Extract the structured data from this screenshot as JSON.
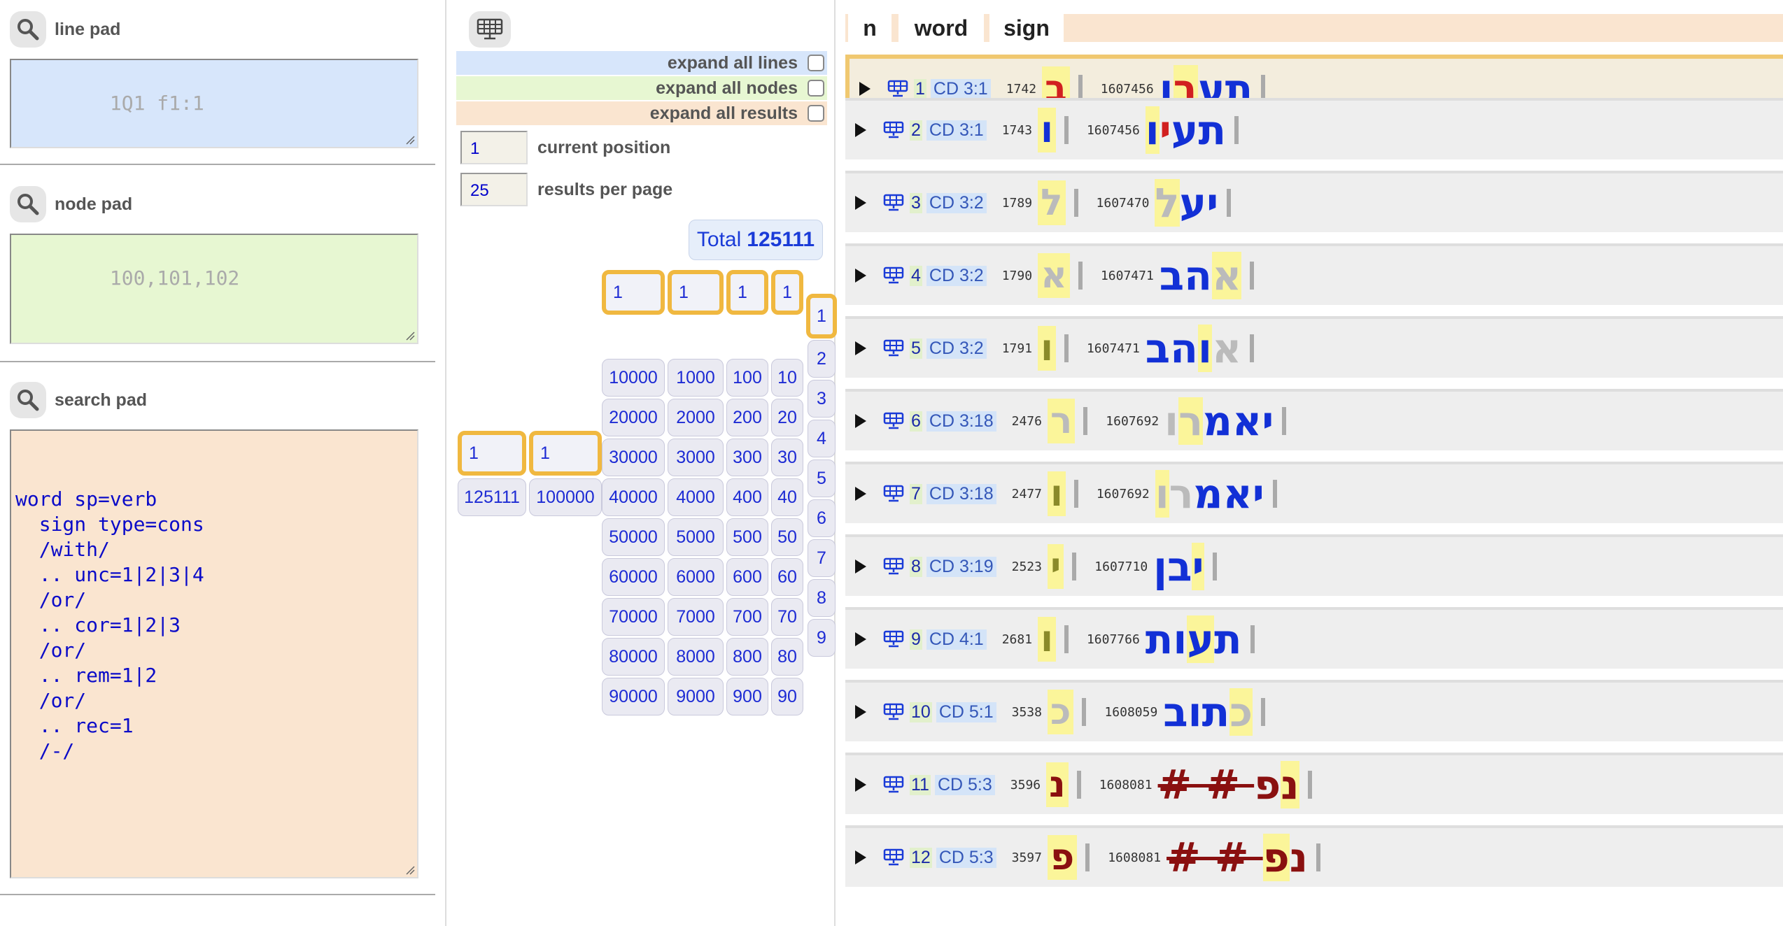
{
  "line_pad": {
    "title": "line pad",
    "placeholder": "1Q1 f1:1"
  },
  "node_pad": {
    "title": "node pad",
    "placeholder": "100,101,102"
  },
  "search_pad": {
    "title": "search pad",
    "lines": [
      "word sp=verb",
      "  sign type=cons",
      "  /with/",
      "  .. unc=1|2|3|4",
      "  /or/",
      "  .. cor=1|2|3",
      "  /or/",
      "  .. rem=1|2",
      "  /or/",
      "  .. rec=1",
      "  /-/"
    ]
  },
  "controls": {
    "expand_lines": "expand all lines",
    "expand_nodes": "expand all nodes",
    "expand_results": "expand all results",
    "current_position_value": "1",
    "current_position_label": "current position",
    "results_per_page_value": "25",
    "results_per_page_label": "results per page",
    "total_label": "Total",
    "total_value": "125111"
  },
  "navigator": {
    "big_selected": [
      "1",
      "1"
    ],
    "big_values": [
      "125111",
      "100000"
    ],
    "col_10000": [
      "1",
      "10000",
      "20000",
      "30000",
      "40000",
      "50000",
      "60000",
      "70000",
      "80000",
      "90000"
    ],
    "col_1000": [
      "1",
      "1000",
      "2000",
      "3000",
      "4000",
      "5000",
      "6000",
      "7000",
      "8000",
      "9000"
    ],
    "col_100": [
      "1",
      "100",
      "200",
      "300",
      "400",
      "500",
      "600",
      "700",
      "800",
      "900"
    ],
    "col_10": [
      "1",
      "10",
      "20",
      "30",
      "40",
      "50",
      "60",
      "70",
      "80",
      "90"
    ],
    "col_1": [
      "1",
      "2",
      "3",
      "4",
      "5",
      "6",
      "7",
      "8",
      "9"
    ]
  },
  "results": {
    "headers": [
      "n",
      "word",
      "sign"
    ],
    "rows": [
      {
        "n": "1",
        "ref": "CD 3:1",
        "sign_node": "1742",
        "sign": "ב",
        "word_node": "1607456"
      },
      {
        "n": "2",
        "ref": "CD 3:1",
        "sign_node": "1743",
        "sign": "ו",
        "word_node": "1607456"
      },
      {
        "n": "3",
        "ref": "CD 3:2",
        "sign_node": "1789",
        "sign": "ל",
        "word_node": "1607470"
      },
      {
        "n": "4",
        "ref": "CD 3:2",
        "sign_node": "1790",
        "sign": "א",
        "word_node": "1607471"
      },
      {
        "n": "5",
        "ref": "CD 3:2",
        "sign_node": "1791",
        "sign": "ו",
        "word_node": "1607471"
      },
      {
        "n": "6",
        "ref": "CD 3:18",
        "sign_node": "2476",
        "sign": "ר",
        "word_node": "1607692"
      },
      {
        "n": "7",
        "ref": "CD 3:18",
        "sign_node": "2477",
        "sign": "ו",
        "word_node": "1607692"
      },
      {
        "n": "8",
        "ref": "CD 3:19",
        "sign_node": "2523",
        "sign": "י",
        "word_node": "1607710"
      },
      {
        "n": "9",
        "ref": "CD 4:1",
        "sign_node": "2681",
        "sign": "ו",
        "word_node": "1607766"
      },
      {
        "n": "10",
        "ref": "CD 5:1",
        "sign_node": "3538",
        "sign": "כ",
        "word_node": "1608059"
      },
      {
        "n": "11",
        "ref": "CD 5:3",
        "sign_node": "3596",
        "sign": "נ",
        "word_node": "1608081"
      },
      {
        "n": "12",
        "ref": "CD 5:3",
        "sign_node": "3597",
        "sign": "פ",
        "word_node": "1608081"
      }
    ]
  },
  "colors": {
    "accent_orange": "#f0b840",
    "line_pad_bg": "#d7e6fb",
    "node_pad_bg": "#e7f7d2",
    "search_pad_bg": "#fae5d0",
    "highlight": "#fbf59a",
    "query_text": "#0b0bc8"
  }
}
